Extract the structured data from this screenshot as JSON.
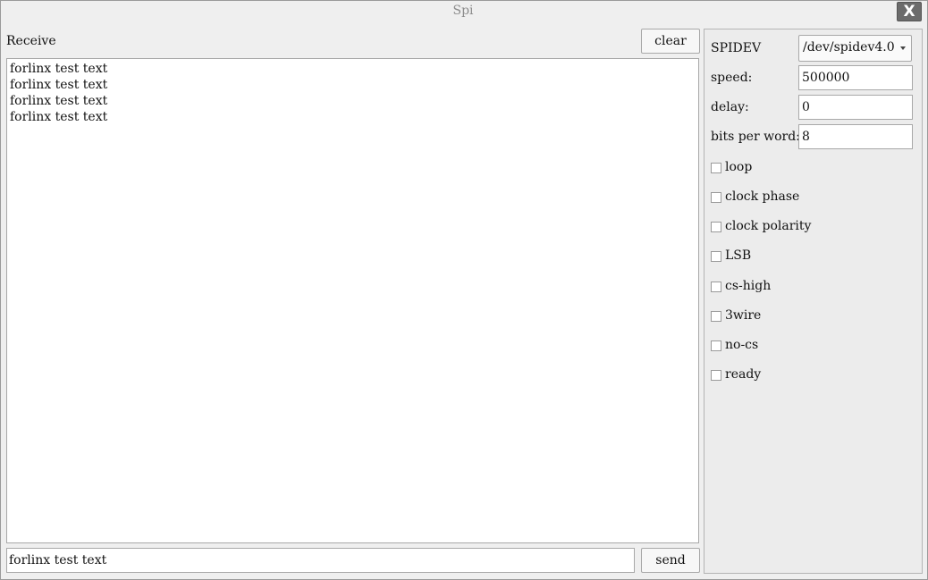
{
  "window": {
    "title": "Spi",
    "close_label": "X"
  },
  "receive": {
    "label": "Receive",
    "clear_label": "clear",
    "lines": [
      "forlinx test text",
      "forlinx test text",
      "forlinx test text",
      "forlinx test text"
    ]
  },
  "send": {
    "input_value": "forlinx test text",
    "send_label": "send"
  },
  "settings": {
    "spidev_label": "SPIDEV",
    "spidev_value": "/dev/spidev4.0",
    "speed_label": "speed:",
    "speed_value": "500000",
    "delay_label": "delay:",
    "delay_value": "0",
    "bits_label": "bits per word:",
    "bits_value": "8",
    "options": [
      {
        "label": "loop",
        "checked": false
      },
      {
        "label": "clock phase",
        "checked": false
      },
      {
        "label": "clock polarity",
        "checked": false
      },
      {
        "label": "LSB",
        "checked": false
      },
      {
        "label": "cs-high",
        "checked": false
      },
      {
        "label": "3wire",
        "checked": false
      },
      {
        "label": "no-cs",
        "checked": false
      },
      {
        "label": "ready",
        "checked": false
      }
    ]
  }
}
